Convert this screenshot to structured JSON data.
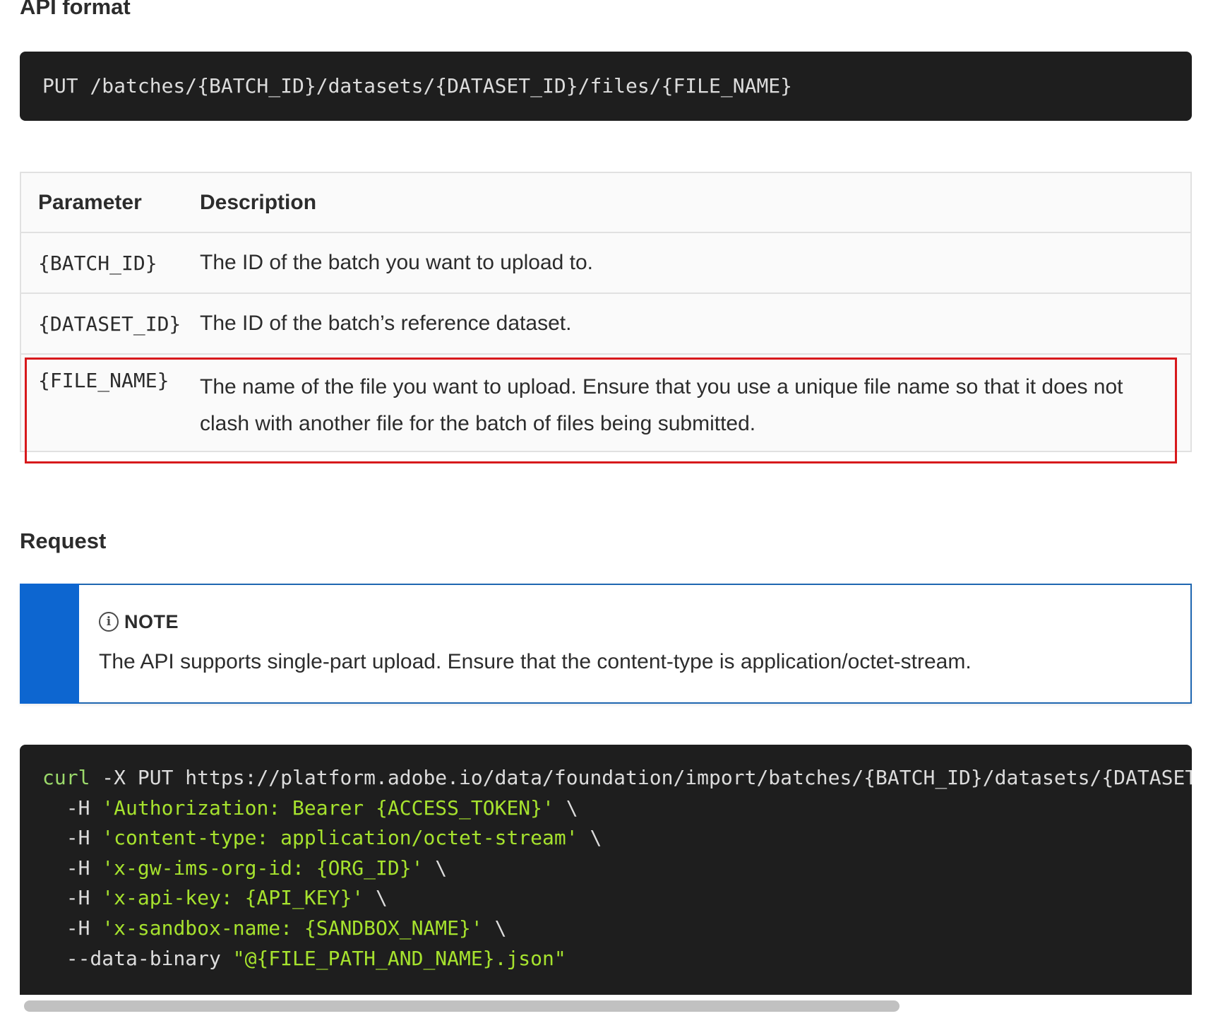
{
  "api_format": {
    "heading": "API format",
    "code": "PUT /batches/{BATCH_ID}/datasets/{DATASET_ID}/files/{FILE_NAME}"
  },
  "param_table": {
    "headers": {
      "parameter": "Parameter",
      "description": "Description"
    },
    "rows": [
      {
        "name": "{BATCH_ID}",
        "description": "The ID of the batch you want to upload to."
      },
      {
        "name": "{DATASET_ID}",
        "description": "The ID of the batch’s reference dataset."
      },
      {
        "name": "{FILE_NAME}",
        "description": "The name of the file you want to upload. Ensure that you use a unique file name so that it does not clash with another file for the batch of files being submitted."
      }
    ]
  },
  "request": {
    "heading": "Request",
    "note": {
      "icon": "info-icon",
      "title": "NOTE",
      "text": "The API supports single-part upload. Ensure that the content-type is application/octet-stream."
    },
    "curl": {
      "line1_cmd": "curl",
      "line1_rest": " -X PUT https://platform.adobe.io/data/foundation/import/batches/{BATCH_ID}/datasets/{DATASET_ID}/files/{FILE_NAME} \\",
      "lines": [
        {
          "flag": "  -H ",
          "str": "'Authorization: Bearer {ACCESS_TOKEN}'",
          "tail": " \\"
        },
        {
          "flag": "  -H ",
          "str": "'content-type: application/octet-stream'",
          "tail": " \\"
        },
        {
          "flag": "  -H ",
          "str": "'x-gw-ims-org-id: {ORG_ID}'",
          "tail": " \\"
        },
        {
          "flag": "  -H ",
          "str": "'x-api-key: {API_KEY}'",
          "tail": " \\"
        },
        {
          "flag": "  -H ",
          "str": "'x-sandbox-name: {SANDBOX_NAME}'",
          "tail": " \\"
        },
        {
          "flag": "  --data-binary ",
          "str": "\"@{FILE_PATH_AND_NAME}.json\"",
          "tail": ""
        }
      ]
    }
  },
  "colors": {
    "code_bg": "#1e1e1e",
    "note_accent": "#0d66d0",
    "highlight": "#d7191c"
  }
}
